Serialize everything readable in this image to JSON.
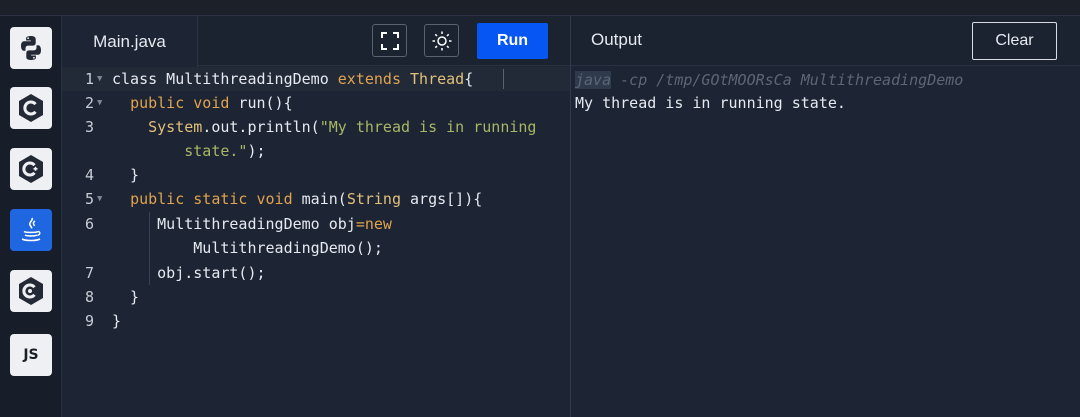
{
  "editor": {
    "file_tab": "Main.java",
    "run_label": "Run",
    "line_numbers": [
      "1",
      "2",
      "3",
      "4",
      "5",
      "6",
      "7",
      "8",
      "9"
    ],
    "lines": {
      "l1a": "class MultithreadingDemo ",
      "l1b": "extends",
      "l1c": " ",
      "l1d": "Thread",
      "l1e": "{",
      "l2a": "  ",
      "l2b": "public void",
      "l2c": " run(){",
      "l3a": "    ",
      "l3b": "System",
      "l3c": ".out.println(",
      "l3d": "\"My thread is in running",
      "l3e": "        state.\"",
      "l3f": ");",
      "l4": "  }",
      "l5a": "  ",
      "l5b": "public static void",
      "l5c": " main(",
      "l5d": "String",
      "l5e": " args[]){",
      "l6a": "     MultithreadingDemo obj",
      "l6b": "=new",
      "l6c": "         MultithreadingDemo();",
      "l7": "     obj.start();",
      "l8": "  }",
      "l9": "}"
    }
  },
  "output": {
    "title": "Output",
    "clear_label": "Clear",
    "command_prefix": "java",
    "command_rest": " -cp /tmp/GOtMOORsCa MultithreadingDemo",
    "result": "My thread is in running state."
  },
  "sidebar": {
    "items": [
      {
        "name": "python",
        "icon": "python-icon"
      },
      {
        "name": "c",
        "icon": "c-icon"
      },
      {
        "name": "cpp",
        "icon": "cpp-icon"
      },
      {
        "name": "java",
        "icon": "java-icon",
        "active": true
      },
      {
        "name": "csharp",
        "icon": "csharp-icon"
      },
      {
        "name": "javascript",
        "label": "JS"
      }
    ],
    "js_label": "JS"
  },
  "colors": {
    "run_button": "#0556f3",
    "active_language": "#1f67e0",
    "keyword": "#e0a34f",
    "string": "#a9b665"
  }
}
